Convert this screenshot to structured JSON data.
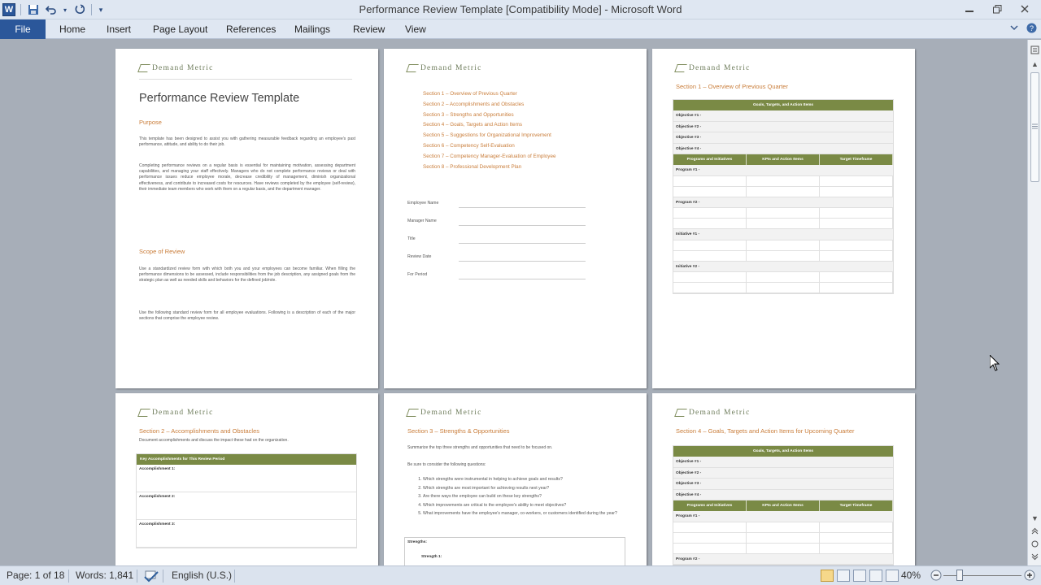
{
  "window": {
    "title": "Performance Review Template [Compatibility Mode]  -  Microsoft Word",
    "app_icon": "W"
  },
  "ribbon": {
    "file": "File",
    "tabs": [
      "Home",
      "Insert",
      "Page Layout",
      "References",
      "Mailings",
      "Review",
      "View"
    ]
  },
  "logo": "Demand Metric",
  "pages": {
    "p1": {
      "title": "Performance Review Template",
      "purpose_heading": "Purpose",
      "purpose_p1": "This template has been designed to assist you with gathering measurable feedback regarding an employee's past performance, attitude, and ability to do their job.",
      "purpose_p2": "Completing performance reviews on a regular basis is essential for maintaining motivation, assessing department capabilities, and managing your staff effectively. Managers who do not complete performance reviews or deal with performance issues reduce employee morale, decrease credibility of management, diminish organizational effectiveness, and contribute to increased costs for resources. Have reviews completed by the employee (self-review), their immediate team members who work with them on a regular basis, and the department manager.",
      "scope_heading": "Scope of Review",
      "scope_p1": "Use a standardized review form with which both you and your employees can become familiar. When filling the performance dimensions to be assessed, include responsibilities from the job description, any assigned goals from the strategic plan as well as needed skills and behaviors for the defined job/role.",
      "scope_p2": "Use the following standard review form for all employee evaluations. Following is a description of each of the major sections that comprise the employee review."
    },
    "p2": {
      "toc": [
        "Section 1 – Overview of Previous Quarter",
        "Section 2 – Accomplishments and Obstacles",
        "Section 3 – Strengths and Opportunities",
        "Section 4 – Goals, Targets and Action Items",
        "Section 5 – Suggestions for Organizational Improvement",
        "Section 6 – Competency Self-Evaluation",
        "Section 7 – Competency Manager-Evaluation of Employee",
        "Section 8 – Professional Development Plan"
      ],
      "fields": [
        "Employee Name",
        "Manager Name",
        "Title",
        "Review Date",
        "For Period"
      ]
    },
    "p3": {
      "heading": "Section 1 – Overview of Previous Quarter",
      "table_header": "Goals, Targets, and Action Items",
      "objectives": [
        "Objective #1 -",
        "Objective #2 -",
        "Objective #3 -",
        "Objective #4 -"
      ],
      "cols": [
        "Programs and Initiatives",
        "KPIs and Action Items",
        "Target Timeframe"
      ],
      "rows": [
        "Program #1 -",
        "Program #2 -",
        "Initiative #1 -",
        "Initiative #2 -"
      ]
    },
    "p4": {
      "heading": "Section 2 – Accomplishments and Obstacles",
      "intro": "Document accomplishments and discuss the impact these had on the organization.",
      "table_header": "Key Accomplishments for This Review Period",
      "rows": [
        "Accomplishment 1:",
        "Accomplishment 2:",
        "Accomplishment 3:"
      ]
    },
    "p5": {
      "heading": "Section 3 – Strengths & Opportunities",
      "intro": "Summarize the top three strengths and opportunities that need to be focused on.",
      "prompt": "Be sure to consider the following questions:",
      "questions": [
        "Which strengths were instrumental in helping to achieve goals and results?",
        "Which strengths are most important for achieving results next year?",
        "Are there ways the employee can build on these key strengths?",
        "Which improvements are critical to the employee's ability to meet objectives?",
        "What improvements have the employee's manager, co-workers, or customers identified during the year?"
      ],
      "box_label": "Strengths:",
      "box_item": "Strength 1:"
    },
    "p6": {
      "heading": "Section 4 – Goals, Targets and Action Items for Upcoming Quarter",
      "table_header": "Goals, Targets, and Action Items",
      "objectives": [
        "Objective #1 -",
        "Objective #2 -",
        "Objective #3 -",
        "Objective #4 -"
      ],
      "cols": [
        "Programs and Initiatives",
        "KPIs and Action Items",
        "Target Timeframe"
      ],
      "rows": [
        "Program #1 -",
        "Program #2 -"
      ]
    }
  },
  "status": {
    "page": "Page: 1 of 18",
    "words": "Words: 1,841",
    "language": "English (U.S.)",
    "zoom": "40%"
  },
  "colors": {
    "accent": "#c97d3a",
    "table_header": "#7a8a45",
    "file_tab": "#2b579a"
  }
}
